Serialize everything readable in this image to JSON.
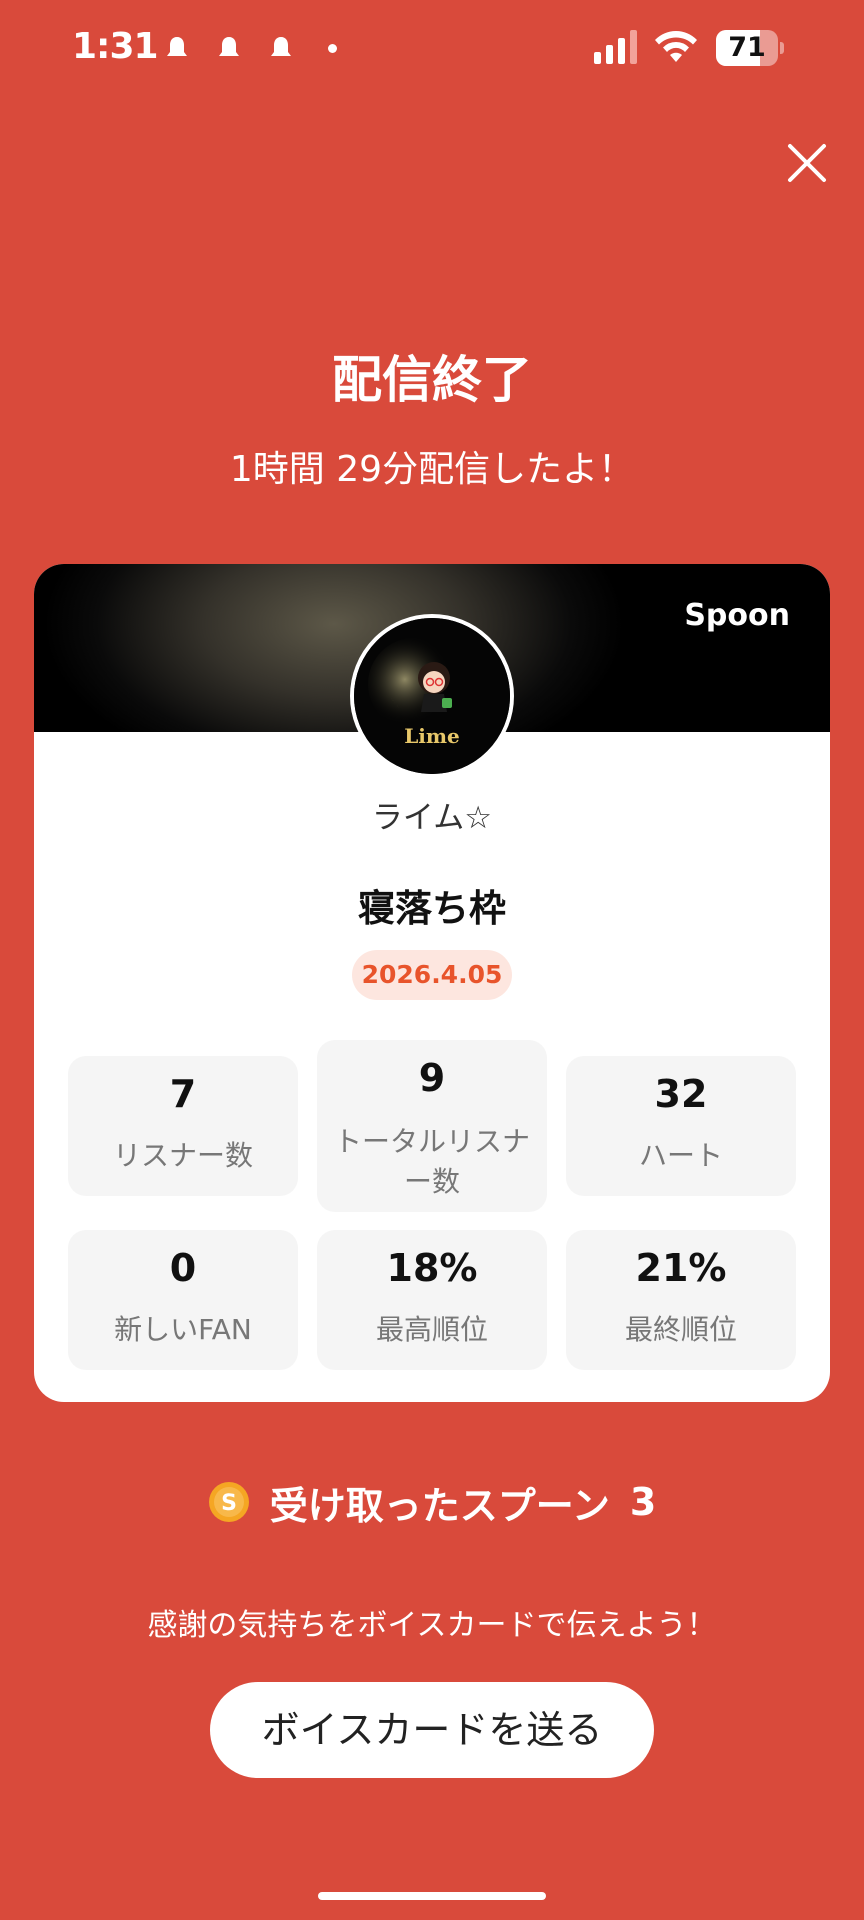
{
  "status_bar": {
    "time": "1:31",
    "battery": "71",
    "battery_level": 0.71,
    "notification_icons": [
      "ghost-icon",
      "ghost-icon",
      "ghost-icon"
    ]
  },
  "header": {
    "title": "配信終了",
    "subtitle": "1時間 29分配信したよ！"
  },
  "card": {
    "brand": "Spoon",
    "avatar_label": "Lime",
    "username": "ライム☆",
    "show_title": "寝落ち枠",
    "date": "2026.4.05",
    "stats": [
      {
        "value": "7",
        "label": "リスナー数"
      },
      {
        "value": "9",
        "label_line1": "トータルリスナ",
        "label_line2": "ー数"
      },
      {
        "value": "32",
        "label": "ハート"
      },
      {
        "value": "0",
        "label": "新しいFAN"
      },
      {
        "value": "18%",
        "label": "最高順位"
      },
      {
        "value": "21%",
        "label": "最終順位"
      }
    ]
  },
  "spoons": {
    "label": "受け取ったスプーン",
    "count": "3",
    "coin_letter": "S"
  },
  "footer": {
    "thanks_text": "感謝の気持ちをボイスカードで伝えよう！",
    "voice_card_button": "ボイスカードを送る"
  },
  "colors": {
    "background": "#D94A3B",
    "date_text": "#E8542B",
    "date_bg": "#FDE6DF",
    "coin": "#F5A623"
  }
}
